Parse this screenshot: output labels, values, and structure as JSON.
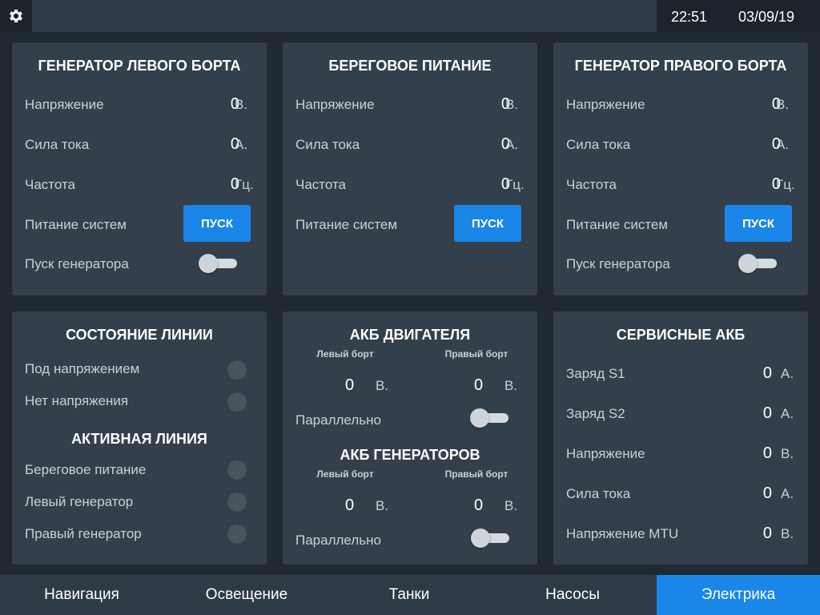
{
  "topbar": {
    "settings_icon": "gear-icon",
    "time": "22:51",
    "date": "03/09/19"
  },
  "left_generator": {
    "title": "ГЕНЕРАТОР ЛЕВОГО БОРТА",
    "voltage": {
      "label": "Напряжение",
      "value": "0",
      "unit": "В."
    },
    "current": {
      "label": "Сила тока",
      "value": "0",
      "unit": "А."
    },
    "frequency": {
      "label": "Частота",
      "value": "0",
      "unit": "Гц."
    },
    "power": {
      "label": "Питание систем",
      "button": "ПУСК"
    },
    "start": {
      "label": "Пуск генератора",
      "state": "off"
    }
  },
  "shore_power": {
    "title": "БЕРЕГОВОЕ ПИТАНИЕ",
    "voltage": {
      "label": "Напряжение",
      "value": "0",
      "unit": "В."
    },
    "current": {
      "label": "Сила тока",
      "value": "0",
      "unit": "А."
    },
    "frequency": {
      "label": "Частота",
      "value": "0",
      "unit": "Гц."
    },
    "power": {
      "label": "Питание систем",
      "button": "ПУСК"
    }
  },
  "right_generator": {
    "title": "ГЕНЕРАТОР ПРАВОГО БОРТА",
    "voltage": {
      "label": "Напряжение",
      "value": "0",
      "unit": "В."
    },
    "current": {
      "label": "Сила тока",
      "value": "0",
      "unit": "А."
    },
    "frequency": {
      "label": "Частота",
      "value": "0",
      "unit": "Гц."
    },
    "power": {
      "label": "Питание систем",
      "button": "ПУСК"
    },
    "start": {
      "label": "Пуск генератора",
      "state": "off"
    }
  },
  "line_state": {
    "title": "СОСТОЯНИЕ ЛИНИИ",
    "energized": "Под напряжением",
    "no_voltage": "Нет напряжения",
    "active_title": "АКТИВНАЯ ЛИНИЯ",
    "shore": "Береговое питание",
    "left_gen": "Левый генератор",
    "right_gen": "Правый генератор"
  },
  "engine_akb": {
    "title": "АКБ ДВИГАТЕЛЯ",
    "left_label": "Левый борт",
    "right_label": "Правый борт",
    "left_value": "0",
    "right_value": "0",
    "unit": "В.",
    "parallel": "Параллельно"
  },
  "gen_akb": {
    "title": "АКБ ГЕНЕРАТОРОВ",
    "left_label": "Левый борт",
    "right_label": "Правый борт",
    "left_value": "0",
    "right_value": "0",
    "unit": "В.",
    "parallel": "Параллельно"
  },
  "service_akb": {
    "title": "СЕРВИСНЫЕ АКБ",
    "rows": [
      {
        "label": "Заряд S1",
        "value": "0",
        "unit": "А."
      },
      {
        "label": "Заряд S2",
        "value": "0",
        "unit": "А."
      },
      {
        "label": "Напряжение",
        "value": "0",
        "unit": "В."
      },
      {
        "label": "Сила тока",
        "value": "0",
        "unit": "А."
      },
      {
        "label": "Напряжение MTU",
        "value": "0",
        "unit": "В."
      }
    ]
  },
  "nav": {
    "items": [
      "Навигация",
      "Освещение",
      "Танки",
      "Насосы",
      "Электрика"
    ],
    "active": "Электрика"
  },
  "colors": {
    "accent": "#1a86e8",
    "panel": "#343f4c",
    "background": "#1f2833",
    "led_off": "#4a545f"
  }
}
